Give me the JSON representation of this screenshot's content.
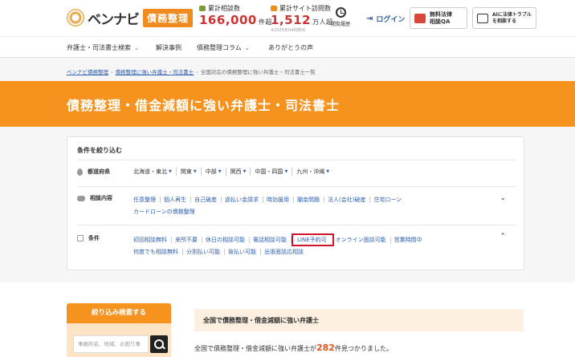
{
  "header": {
    "logo_text": "ベンナビ",
    "logo_badge": "債務整理",
    "stats": [
      {
        "label": "累計相談数",
        "value": "166,000",
        "unit": "件超",
        "note": ""
      },
      {
        "label": "累計サイト訪問数",
        "value": "1,512",
        "unit": "万人超",
        "note": "※2025年04月時点"
      }
    ],
    "history_label": "閲覧履歴",
    "login_label": "ログイン",
    "qa_button": [
      "無料法律",
      "相談QA"
    ],
    "ai_button": [
      "AIに法律トラブル",
      "を相談する"
    ]
  },
  "nav": {
    "items": [
      {
        "label": "弁護士・司法書士検索",
        "dropdown": true
      },
      {
        "label": "解決事例",
        "dropdown": false
      },
      {
        "label": "債務整理コラム",
        "dropdown": true
      },
      {
        "label": "ありがとうの声",
        "dropdown": false
      }
    ]
  },
  "breadcrumb": [
    "ベンナビ債務整理",
    "債務整理に強い弁護士・司法書士",
    "全国対応の債務整理に強い弁護士・司法書士一覧"
  ],
  "banner_title": "債務整理・借金減額に強い弁護士・司法書士",
  "filter": {
    "title": "条件を絞り込む",
    "region_label": "都道府県",
    "regions": [
      "北海道・東北",
      "関東",
      "中部",
      "関西",
      "中国・四国",
      "九州・沖縄"
    ],
    "consult_label": "相談内容",
    "consult_items": [
      "任意整理",
      "個人再生",
      "自己破産",
      "過払い金請求",
      "時効援用",
      "闇金問題",
      "法人(会社)破産",
      "住宅ローン",
      "カードローンの債務整理"
    ],
    "condition_label": "条件",
    "condition_items": [
      "初回相談無料",
      "来所不要",
      "休日の相談可能",
      "電話相談可能",
      "LINE予約可",
      "オンライン面談可能",
      "営業時間中",
      "何度でも相談無料",
      "分割払い可能",
      "後払い可能",
      "出張面談応相談"
    ],
    "highlighted_condition": "LINE予約可"
  },
  "sidebar": {
    "title": "絞り込み検索する",
    "search_placeholder": "事務所名、地域、お困り事"
  },
  "results": {
    "heading": "全国で債務整理・借金減額に強い弁護士",
    "prefix": "全国で債務整理・借金減額に強い弁護士が",
    "count": "282",
    "suffix": "件見つかりました。"
  },
  "colors": {
    "accent": "#f6931e",
    "link": "#2f5fad",
    "highlight_box": "#d2132c",
    "count": "#e0561c"
  }
}
